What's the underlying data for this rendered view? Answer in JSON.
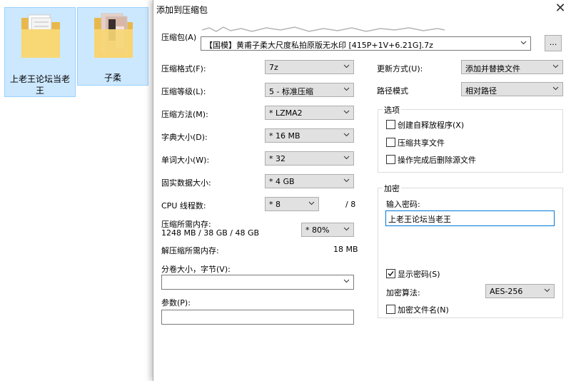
{
  "desktop": {
    "icons": [
      {
        "label": "上老王论坛当老王",
        "icon": "folder-icon"
      },
      {
        "label": "子柔",
        "icon": "folder-icon"
      }
    ]
  },
  "dialog": {
    "title": "添加到压缩包",
    "archive": {
      "label": "压缩包(A)",
      "value": "【国模】黄甫子柔大尺度私拍原版无水印 [415P+1V+6.21G].7z",
      "browse": "..."
    },
    "left": {
      "format": {
        "label": "压缩格式(F):",
        "value": "7z"
      },
      "level": {
        "label": "压缩等级(L):",
        "value": "5 - 标准压缩"
      },
      "method": {
        "label": "压缩方法(M):",
        "value": "* LZMA2"
      },
      "dict": {
        "label": "字典大小(D):",
        "value": "* 16 MB"
      },
      "word": {
        "label": "单词大小(W):",
        "value": "* 32"
      },
      "solid": {
        "label": "固实数据大小:",
        "value": "* 4 GB"
      },
      "cpu": {
        "label": "CPU 线程数:",
        "value": "* 8",
        "max": "/ 8"
      },
      "mem": {
        "label": "压缩所需内存:",
        "detail": "1248 MB / 38 GB / 48 GB",
        "value": "* 80%"
      },
      "demem": {
        "label": "解压缩所需内存:",
        "value": "18 MB"
      },
      "split": {
        "label": "分卷大小，字节(V):",
        "value": ""
      },
      "params": {
        "label": "参数(P):",
        "value": ""
      }
    },
    "right": {
      "update": {
        "label": "更新方式(U):",
        "value": "添加并替换文件"
      },
      "path": {
        "label": "路径模式",
        "value": "相对路径"
      },
      "options": {
        "title": "选项",
        "sfx": {
          "label": "创建自释放程序(X)",
          "checked": false
        },
        "shared": {
          "label": "压缩共享文件",
          "checked": false
        },
        "delete": {
          "label": "操作完成后删除源文件",
          "checked": false
        }
      },
      "encrypt": {
        "title": "加密",
        "pwd_label": "输入密码:",
        "pwd_value": "上老王论坛当老王",
        "show_pwd": {
          "label": "显示密码(S)",
          "checked": true
        },
        "method": {
          "label": "加密算法:",
          "value": "AES-256"
        },
        "names": {
          "label": "加密文件名(N)",
          "checked": false
        }
      }
    }
  }
}
